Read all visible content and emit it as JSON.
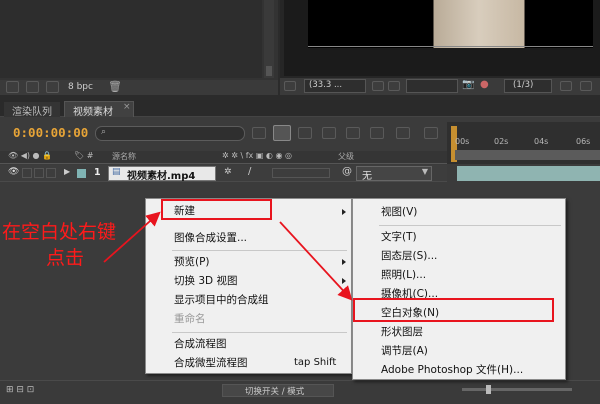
{
  "top_bar": {
    "bit_depth": "8 bpc",
    "zoom": "(33.3 ...",
    "resolution": "(1/3)"
  },
  "tabs": [
    {
      "label": "渲染队列"
    },
    {
      "label": "视频素材"
    }
  ],
  "timeline": {
    "timecode": "0:00:00:00",
    "search_placeholder": "",
    "time_ticks": [
      "00s",
      "02s",
      "04s",
      "06s"
    ],
    "header": {
      "source_name": "源名称",
      "parent": "父级"
    },
    "layer": {
      "number": "1",
      "name": "视频素材.mp4",
      "parent_value": "无"
    },
    "footer_toggle": "切换开关 / 模式"
  },
  "context_menu": {
    "items": [
      {
        "label": "新建",
        "submenu": true
      },
      {
        "label": "图像合成设置..."
      },
      {
        "label": "预览(P)",
        "submenu": true
      },
      {
        "label": "切换 3D 视图",
        "submenu": true
      },
      {
        "label": "显示项目中的合成组"
      },
      {
        "label": "重命名",
        "disabled": true
      },
      {
        "label": "合成流程图"
      },
      {
        "label": "合成微型流程图",
        "shortcut": "tap Shift"
      }
    ]
  },
  "submenu": {
    "items": [
      {
        "label": "视图(V)"
      },
      {
        "label": "文字(T)"
      },
      {
        "label": "固态层(S)..."
      },
      {
        "label": "照明(L)..."
      },
      {
        "label": "摄像机(C)..."
      },
      {
        "label": "空白对象(N)",
        "highlighted": true
      },
      {
        "label": "形状图层"
      },
      {
        "label": "调节层(A)"
      },
      {
        "label": "Adobe Photoshop 文件(H)..."
      }
    ]
  },
  "annotation": {
    "line1": "在空白处右键",
    "line2": "点击",
    "color": "#ff1a1a"
  },
  "colors": {
    "timecode": "#e7a437",
    "highlight_box": "#e8141e",
    "playhead": "#e0a030"
  }
}
